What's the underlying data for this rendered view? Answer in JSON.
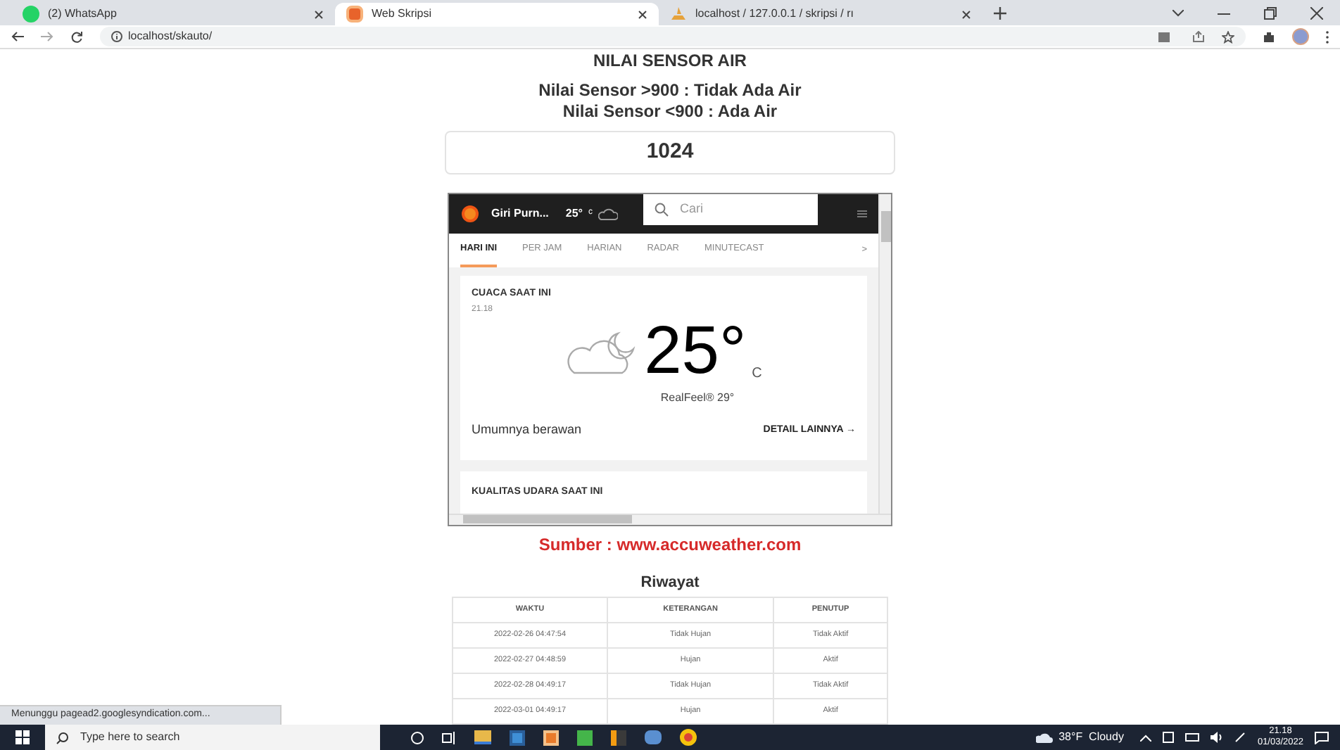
{
  "browser": {
    "tabs": [
      {
        "title": "(2) WhatsApp",
        "kind": "chat",
        "selected": false
      },
      {
        "title": "Web Skripsi",
        "kind": "site",
        "selected": true
      },
      {
        "title": "localhost / 127.0.0.1 / skripsi / rı",
        "kind": "database",
        "selected": false
      }
    ],
    "address": "localhost/skauto/"
  },
  "page": {
    "title": "NILAI SENSOR AIR",
    "rules": [
      "Nilai Sensor >900 : Tidak Ada Air",
      "Nilai Sensor <900 : Ada Air"
    ],
    "value": "1024",
    "weather": {
      "location": "Giri Purn...",
      "header_temp": "25°",
      "header_unit": "c",
      "search_placeholder": "Cari",
      "tabs": [
        {
          "label": "HARI INI",
          "selected": true
        },
        {
          "label": "PER JAM",
          "selected": false
        },
        {
          "label": "HARIAN",
          "selected": false
        },
        {
          "label": "RADAR",
          "selected": false
        },
        {
          "label": "MINUTECAST",
          "selected": false
        }
      ],
      "more": ">",
      "card_title": "CUACA SAAT INI",
      "time": "21.18",
      "temp": "25°",
      "unit": "C",
      "realfeel": "RealFeel® 29°",
      "condition": "Umumnya berawan",
      "detail": "DETAIL LAINNYA →",
      "next_card": "KUALITAS UDARA SAAT INI"
    },
    "source": "Sumber : www.accuweather.com",
    "history": {
      "title": "Riwayat",
      "columns": [
        "WAKTU",
        "KETERANGAN",
        "PENUTUP"
      ],
      "rows": [
        [
          "2022-02-26 04:47:54",
          "Tidak Hujan",
          "Tidak Aktif"
        ],
        [
          "2022-02-27 04:48:59",
          "Hujan",
          "Aktif"
        ],
        [
          "2022-02-28 04:49:17",
          "Tidak Hujan",
          "Tidak Aktif"
        ],
        [
          "2022-03-01 04:49:17",
          "Hujan",
          "Aktif"
        ]
      ]
    }
  },
  "status": "Menunggu pagead2.googlesyndication.com...",
  "taskbar": {
    "search_placeholder": "Type here to search",
    "weather": "38°F  Cloudy",
    "time": "21.18",
    "date": "01/03/2022"
  }
}
